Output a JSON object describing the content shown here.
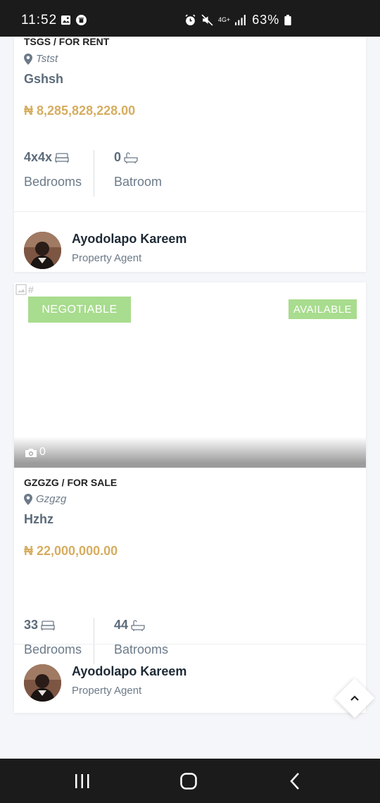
{
  "status_bar": {
    "time": "11:52",
    "network": "4G+",
    "battery": "63%"
  },
  "listings": [
    {
      "category": "TSGS / FOR RENT",
      "location": "Tstst",
      "title": "Gshsh",
      "price": "₦ 8,285,828,228.00",
      "bedrooms_value": "4x4x",
      "bedrooms_label": "Bedrooms",
      "bathrooms_value": "0",
      "bathrooms_label": "Batroom",
      "agent_name": "Ayodolapo Kareem",
      "agent_role": "Property Agent"
    },
    {
      "image_alt": "#",
      "badge_left": "NEGOTIABLE",
      "badge_right": "AVAILABLE",
      "photo_count": "0",
      "category": "GZGZG / FOR SALE",
      "location": "Gzgzg",
      "title": "Hzhz",
      "price": "₦ 22,000,000.00",
      "bedrooms_value": "33",
      "bedrooms_label": "Bedrooms",
      "bathrooms_value": "44",
      "bathrooms_label": "Batrooms",
      "agent_name": "Ayodolapo Kareem",
      "agent_role": "Property Agent"
    }
  ],
  "colors": {
    "price": "#d6ad60",
    "badge": "#a8dc8e",
    "text_muted": "#6c7a89"
  },
  "icons": [
    "image-icon",
    "trash-icon",
    "alarm-icon",
    "mute-icon",
    "signal-icon",
    "battery-icon",
    "map-pin-icon",
    "bed-icon",
    "bath-icon",
    "camera-icon",
    "chevron-up-icon",
    "recent-apps-icon",
    "home-icon",
    "back-icon"
  ]
}
